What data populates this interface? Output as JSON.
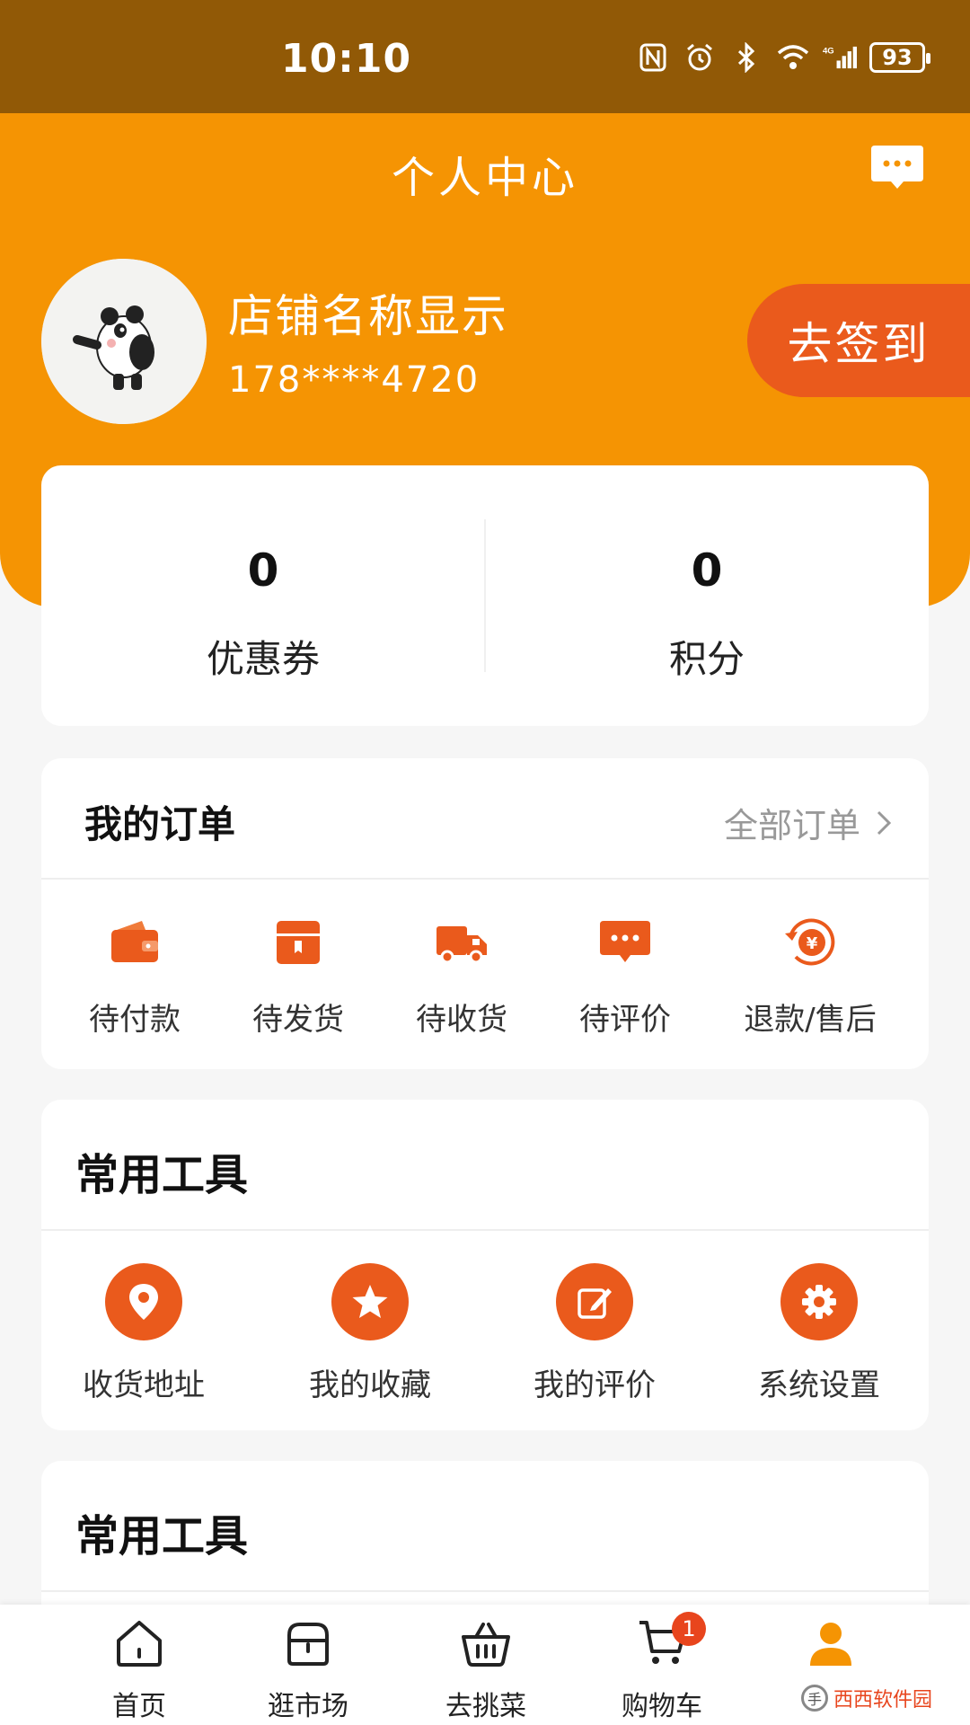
{
  "status_bar": {
    "time": "10:10",
    "battery": "93",
    "icons": [
      "nfc-icon",
      "alarm-icon",
      "bluetooth-icon",
      "wifi-icon",
      "signal-4g-icon",
      "battery-icon"
    ]
  },
  "header": {
    "title": "个人中心",
    "shop_name": "店铺名称显示",
    "phone": "178****4720",
    "checkin_label": "去签到",
    "accent_color": "#f59403",
    "button_color": "#ea5a1c"
  },
  "stats": [
    {
      "value": "0",
      "label": "优惠券"
    },
    {
      "value": "0",
      "label": "积分"
    }
  ],
  "orders": {
    "title": "我的订单",
    "all_label": "全部订单",
    "items": [
      {
        "label": "待付款",
        "icon": "wallet-icon"
      },
      {
        "label": "待发货",
        "icon": "package-icon"
      },
      {
        "label": "待收货",
        "icon": "truck-icon"
      },
      {
        "label": "待评价",
        "icon": "comment-icon"
      },
      {
        "label": "退款/售后",
        "icon": "refund-icon"
      }
    ]
  },
  "tools": {
    "title": "常用工具",
    "items": [
      {
        "label": "收货地址",
        "icon": "location-icon"
      },
      {
        "label": "我的收藏",
        "icon": "star-icon"
      },
      {
        "label": "我的评价",
        "icon": "edit-icon"
      },
      {
        "label": "系统设置",
        "icon": "gear-icon"
      }
    ]
  },
  "tools2": {
    "title": "常用工具"
  },
  "nav": {
    "items": [
      {
        "label": "首页",
        "icon": "home-icon"
      },
      {
        "label": "逛市场",
        "icon": "store-icon"
      },
      {
        "label": "去挑菜",
        "icon": "basket-icon"
      },
      {
        "label": "购物车",
        "icon": "cart-icon"
      },
      {
        "label": "",
        "icon": "user-icon"
      }
    ],
    "cart_badge": "1"
  },
  "watermark": {
    "text": "西西软件园"
  }
}
